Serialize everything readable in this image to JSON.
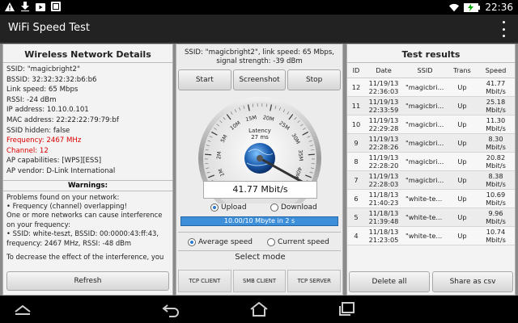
{
  "status": {
    "time": "22:36",
    "icons": [
      "warning-icon",
      "download-icon",
      "play-store-icon",
      "media-icon",
      "wifi-icon",
      "battery-charging-icon"
    ]
  },
  "app": {
    "title": "WiFi Speed Test"
  },
  "left": {
    "title": "Wireless Network Details",
    "lines": [
      "SSID: \"magicbright2\"",
      "BSSID: 32:32:32:32:b6:b6",
      "Link speed: 65 Mbps",
      "RSSI: -24 dBm",
      "IP address: 10.10.0.101",
      "MAC address: 22:22:22:79:79:bf",
      "SSID hidden: false"
    ],
    "frequency": "Frequency: 2467 MHz",
    "channel": "Channel: 12",
    "ap_capabilities": "AP capabilities: [WPS][ESS]",
    "ap_vendor": "AP vendor: D-Link International",
    "warnings_title": "Warnings:",
    "warnings": [
      "Problems found on your network:",
      " • Frequency (channel) overlapping!",
      " One or more networks can cause interference on your frequency:",
      " • SSID: white-teszt, BSSID: 00:0000:43:ff:43, frequency: 2467 MHz, RSSI: -48 dBm",
      "",
      " To decrease the effect of the interference, you"
    ],
    "refresh_label": "Refresh"
  },
  "mid": {
    "ssid_info_1": "SSID: \"magicbright2\", link speed: 65 Mbps,",
    "ssid_info_2": "signal strength: -39 dBm",
    "start_label": "Start",
    "screenshot_label": "Screenshot",
    "stop_label": "Stop",
    "gauge": {
      "ticks": [
        "0M",
        "1M",
        "2M",
        "5M",
        "10M",
        "15M",
        "20M",
        "25M",
        "30M",
        "35M",
        "40M",
        "45M"
      ],
      "latency_label": "Latency",
      "latency_value": "27 ms",
      "needle_value": 41.77,
      "max": 45
    },
    "speed_readout": "41.77 Mbit/s",
    "upload_label": "Upload",
    "download_label": "Download",
    "direction_selected": "upload",
    "progress_text": "10.00/10 Mbyte in 2 s",
    "average_label": "Average speed",
    "current_label": "Current speed",
    "speed_mode_selected": "average",
    "select_mode_title": "Select mode",
    "mode_tcp_client": "TCP CLIENT",
    "mode_smb_client": "SMB CLIENT",
    "mode_tcp_server": "TCP SERVER"
  },
  "right": {
    "title": "Test results",
    "columns": [
      "ID",
      "Date",
      "SSID",
      "Trans",
      "Speed"
    ],
    "rows": [
      {
        "id": "12",
        "date1": "11/19/13",
        "date2": "22:36:03",
        "ssid": "\"magicbri...",
        "trans": "Up",
        "speed1": "41.77",
        "speed2": "Mbit/s"
      },
      {
        "id": "11",
        "date1": "11/19/13",
        "date2": "22:33:59",
        "ssid": "\"magicbri...",
        "trans": "Up",
        "speed1": "25.18",
        "speed2": "Mbit/s"
      },
      {
        "id": "10",
        "date1": "11/19/13",
        "date2": "22:29:28",
        "ssid": "\"magicbri...",
        "trans": "Up",
        "speed1": "11.30",
        "speed2": "Mbit/s"
      },
      {
        "id": "9",
        "date1": "11/19/13",
        "date2": "22:28:26",
        "ssid": "\"magicbri...",
        "trans": "Up",
        "speed1": "8.30",
        "speed2": "Mbit/s"
      },
      {
        "id": "8",
        "date1": "11/19/13",
        "date2": "22:28:20",
        "ssid": "\"magicbri...",
        "trans": "Up",
        "speed1": "20.82",
        "speed2": "Mbit/s"
      },
      {
        "id": "7",
        "date1": "11/19/13",
        "date2": "22:28:03",
        "ssid": "\"magicbri...",
        "trans": "Up",
        "speed1": "8.38",
        "speed2": "Mbit/s"
      },
      {
        "id": "6",
        "date1": "11/18/13",
        "date2": "21:40:23",
        "ssid": "\"white-te...",
        "trans": "Up",
        "speed1": "10.69",
        "speed2": "Mbit/s"
      },
      {
        "id": "5",
        "date1": "11/18/13",
        "date2": "21:39:48",
        "ssid": "\"white-te...",
        "trans": "Up",
        "speed1": "9.96",
        "speed2": "Mbit/s"
      },
      {
        "id": "4",
        "date1": "11/18/13",
        "date2": "21:23:05",
        "ssid": "\"white-te...",
        "trans": "Up",
        "speed1": "10.74",
        "speed2": "Mbit/s"
      }
    ],
    "delete_label": "Delete all",
    "share_label": "Share as csv"
  },
  "nav": {
    "icons": [
      "back-nav-icon",
      "home-nav-icon",
      "recent-apps-icon",
      "collapse-nav-icon"
    ]
  },
  "colors": {
    "accent": "#3d8fd9",
    "warning_red": "#dd0000",
    "globe": "#1d5fb0"
  }
}
